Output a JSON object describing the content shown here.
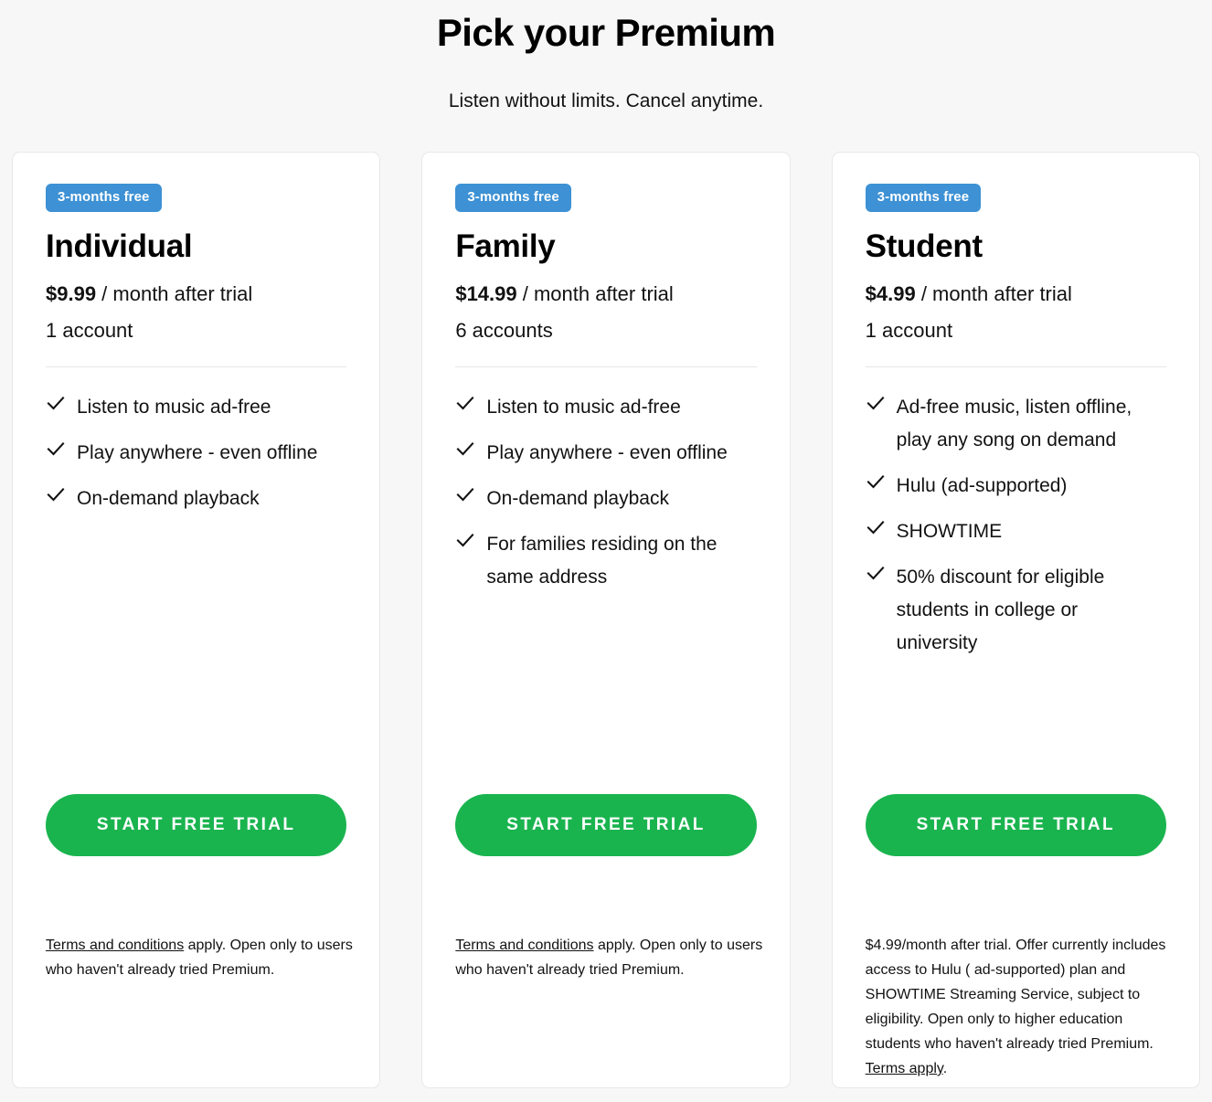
{
  "header": {
    "title": "Pick your Premium",
    "subtitle": "Listen without limits. Cancel anytime."
  },
  "colors": {
    "page_background": "#f7f7f7",
    "card_background": "#ffffff",
    "card_border": "#e8e8e8",
    "badge_blue": "#3d91d4",
    "cta_green": "#1ab44f",
    "text": "#121212",
    "divider": "#e6e6e6"
  },
  "icons": {
    "check": "check-icon"
  },
  "plans": [
    {
      "badge": "3-months free",
      "name": "Individual",
      "price_amount": "$9.99",
      "price_suffix": " / month after trial",
      "accounts": "1 account",
      "features": [
        "Listen to music ad-free",
        "Play anywhere - even offline",
        "On-demand playback"
      ],
      "cta_label": "START FREE TRIAL",
      "fine_print": {
        "link_text": "Terms and conditions",
        "rest_text": " apply. Open only to users who haven't already tried Premium.",
        "link_at": "start"
      }
    },
    {
      "badge": "3-months free",
      "name": "Family",
      "price_amount": "$14.99",
      "price_suffix": " / month after trial",
      "accounts": "6 accounts",
      "features": [
        "Listen to music ad-free",
        "Play anywhere - even offline",
        "On-demand playback",
        "For families residing on the same address"
      ],
      "cta_label": "START FREE TRIAL",
      "fine_print": {
        "link_text": "Terms and conditions",
        "rest_text": " apply. Open only to users who haven't already tried Premium.",
        "link_at": "start"
      }
    },
    {
      "badge": "3-months free",
      "name": "Student",
      "price_amount": "$4.99",
      "price_suffix": " / month after trial",
      "accounts": "1 account",
      "features": [
        "Ad-free music, listen offline, play any song on demand",
        "Hulu (ad-supported)",
        "SHOWTIME",
        "50% discount for eligible students in college or university"
      ],
      "cta_label": "START FREE TRIAL",
      "fine_print": {
        "lead_text": "$4.99/month after trial. Offer currently includes access to Hulu ( ad-supported) plan and SHOWTIME Streaming Service, subject to eligibility. Open only to higher education students who haven't already tried Premium. ",
        "link_text": "Terms apply",
        "rest_text": ".",
        "link_at": "end"
      }
    }
  ]
}
